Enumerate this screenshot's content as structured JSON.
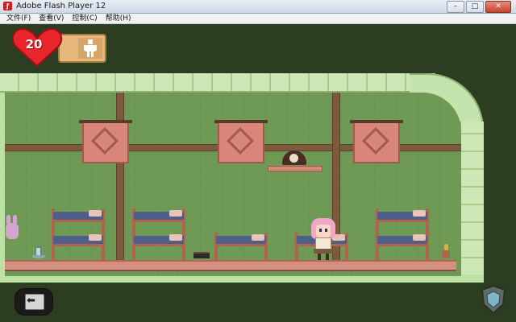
{
  "window": {
    "title": "Adobe Flash Player 12",
    "app_icon": "flash-icon",
    "buttons": [
      "–",
      "□",
      "✕"
    ]
  },
  "menubar": {
    "items": [
      {
        "label": "文件(F)"
      },
      {
        "label": "查看(V)"
      },
      {
        "label": "控制(C)"
      },
      {
        "label": "帮助(H)"
      }
    ]
  },
  "hud": {
    "health": "20",
    "health_icon": "heart-icon",
    "companion_icon": "person-icon",
    "heart_color": "#e8262b"
  },
  "controls": {
    "back_icon": "back-arrow-icon",
    "back_glyph": "⬅",
    "shield_icon": "shield-icon"
  },
  "colors": {
    "wall": "#6e9a55",
    "stone": "#bfe0a4",
    "wood": "#7d5a3c",
    "bed_frame": "#b5624d",
    "blanket": "#4e5f8a",
    "tapestry": "#d9867a"
  }
}
